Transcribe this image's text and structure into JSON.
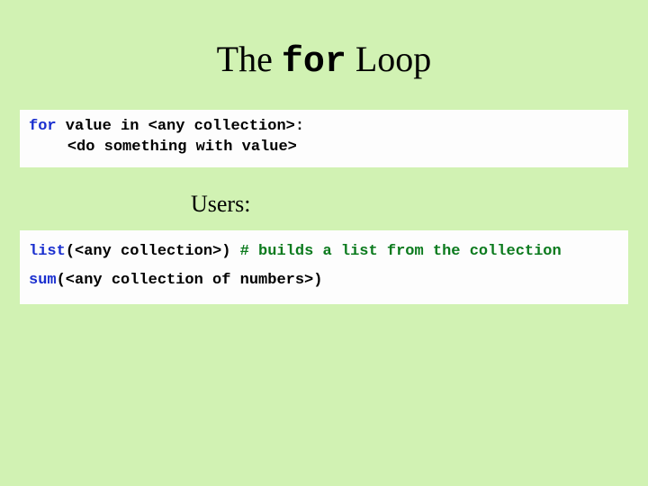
{
  "title": {
    "pre": "The ",
    "mono": "for",
    "post": " Loop"
  },
  "box1": {
    "l1_kw": "for",
    "l1_rest": " value in <any collection>:",
    "l2": "<do something with value>"
  },
  "subheading": "Users:",
  "box2": {
    "l1_a": "list",
    "l1_b": "(<any collection>)   ",
    "l1_c": "# builds a list from the collection",
    "l2_a": "sum",
    "l2_b": "(<any collection of numbers>)"
  }
}
